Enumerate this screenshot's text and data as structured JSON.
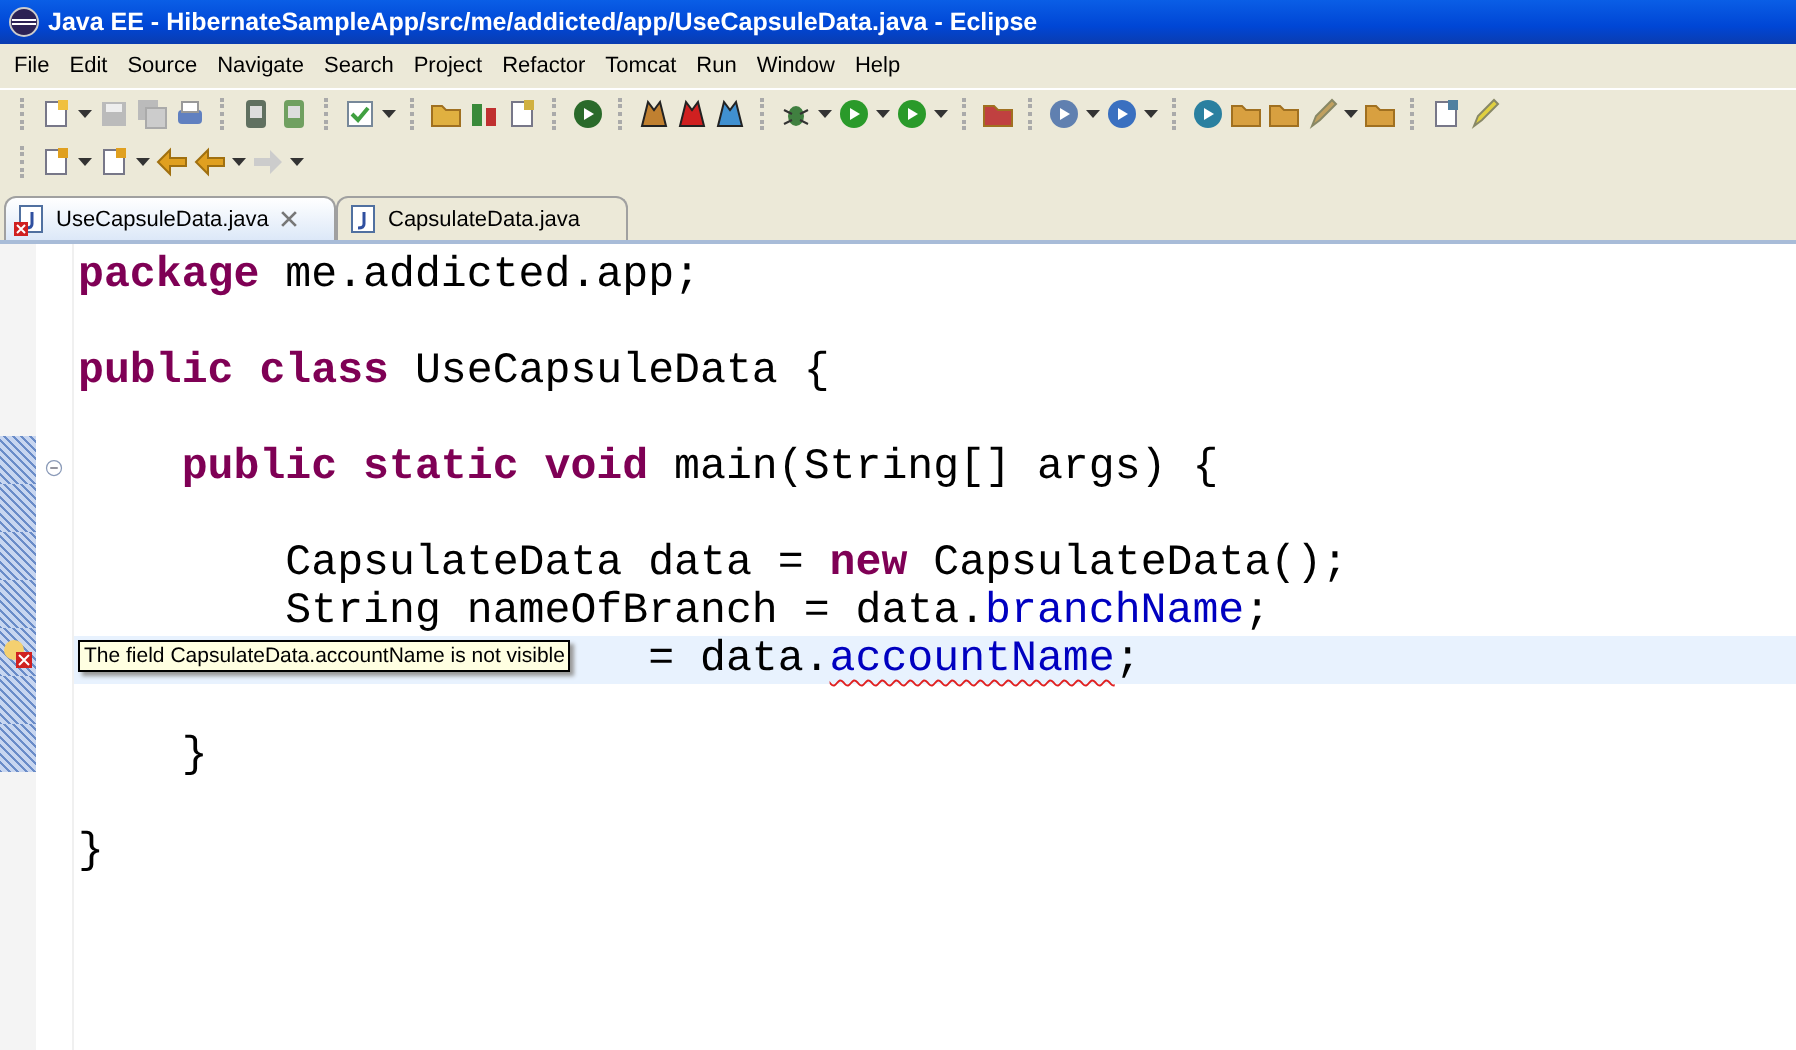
{
  "window": {
    "title": "Java EE - HibernateSampleApp/src/me/addicted/app/UseCapsuleData.java - Eclipse"
  },
  "menu": [
    "File",
    "Edit",
    "Source",
    "Navigate",
    "Search",
    "Project",
    "Refactor",
    "Tomcat",
    "Run",
    "Window",
    "Help"
  ],
  "tabs": [
    {
      "label": "UseCapsuleData.java",
      "selected": true,
      "error": true
    },
    {
      "label": "CapsulateData.java",
      "selected": false,
      "error": false
    }
  ],
  "editor": {
    "lines": [
      {
        "tokens": [
          {
            "kind": "keyword",
            "text": "package"
          },
          {
            "kind": "plain",
            "text": " me.addicted.app;"
          }
        ]
      },
      {
        "blank_before": true,
        "tokens": [
          {
            "kind": "keyword",
            "text": "public class"
          },
          {
            "kind": "plain",
            "text": " UseCapsuleData {"
          }
        ]
      },
      {
        "blank_before": true,
        "fold": true,
        "tokens": [
          {
            "kind": "keyword",
            "text": "    public static void"
          },
          {
            "kind": "plain",
            "text": " main(String[] args) {"
          }
        ]
      },
      {
        "blank_before": true,
        "tokens": [
          {
            "kind": "plain",
            "text": "        CapsulateData data = "
          },
          {
            "kind": "keyword",
            "text": "new"
          },
          {
            "kind": "plain",
            "text": " CapsulateData();"
          }
        ]
      },
      {
        "tokens": [
          {
            "kind": "plain",
            "text": "        String nameOfBranch = data."
          },
          {
            "kind": "field",
            "text": "branchName"
          },
          {
            "kind": "plain",
            "text": ";"
          }
        ]
      },
      {
        "current": true,
        "error": true,
        "tooltip": "The field CapsulateData.accountName is not visible",
        "tokens": [
          {
            "kind": "plain",
            "text": "                      = data."
          },
          {
            "kind": "error-field",
            "text": "accountName"
          },
          {
            "kind": "plain",
            "text": ";"
          }
        ]
      },
      {
        "blank_before": true,
        "tokens": [
          {
            "kind": "plain",
            "text": "    }"
          }
        ]
      },
      {
        "blank_before": true,
        "tokens": [
          {
            "kind": "plain",
            "text": "}"
          }
        ]
      }
    ]
  }
}
